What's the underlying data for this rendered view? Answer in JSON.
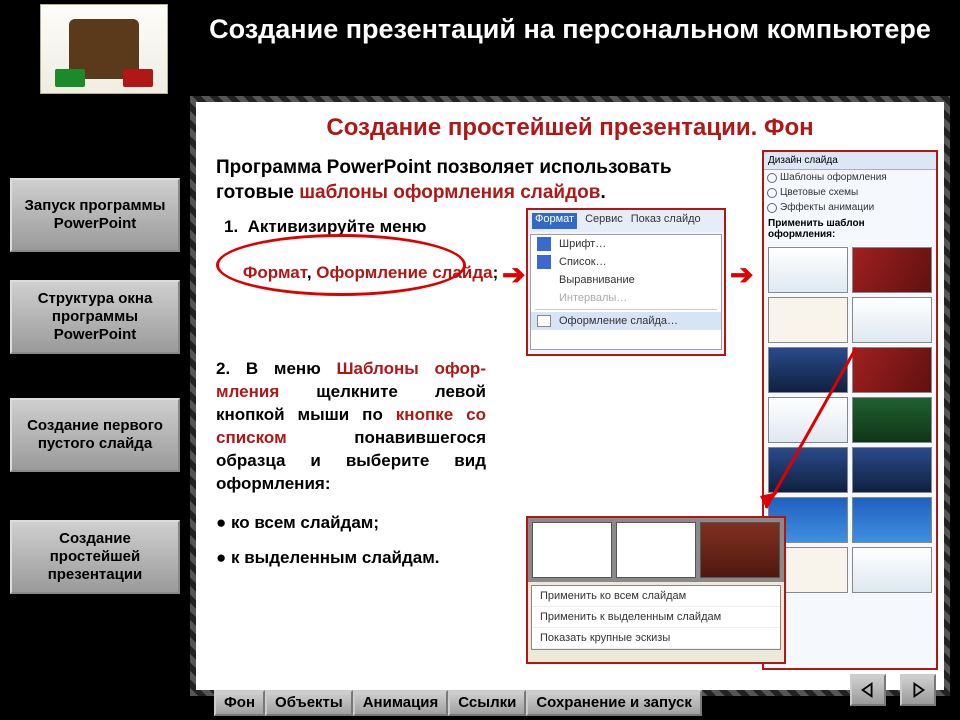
{
  "header": {
    "title": "Создание презентаций на персональном компьютере",
    "subtitle": "Создание простейшей презентации. Фон"
  },
  "sidebar": {
    "buttons": [
      "Запуск программы PowerPoint",
      "Структура окна программы PowerPoint",
      "Создание первого пустого слайда",
      "Создание простейшей презентации"
    ]
  },
  "content": {
    "intro_plain": "Программа PowerPoint позволяет использовать готовые ",
    "intro_red": "шаблоны оформления слайдов",
    "intro_end": ".",
    "step1_num": "1.",
    "step1_a": "Активизируйте меню",
    "step1_red1": "Формат",
    "step1_comma": ", ",
    "step1_red2": "Оформление слайда",
    "step1_end": ";",
    "step2_a": "2. В меню ",
    "step2_red1": "Шаблоны офор­мления",
    "step2_b": " щелкните левой кнопкой мыши по ",
    "step2_red2": "кнопке со списком",
    "step2_c": " понавившегося образца и выберите вид оформления:",
    "bullet1": "● ко всем слайдам;",
    "bullet2": "● к выделенным слайдам."
  },
  "menu": {
    "bar": [
      "Формат",
      "Сервис",
      "Показ слайдо"
    ],
    "items": [
      "Шрифт…",
      "Список…",
      "Выравнивание",
      "Интервалы…",
      "Оформление слайда…"
    ]
  },
  "panel": {
    "header": "Дизайн слайда",
    "opts": [
      "Шаблоны оформления",
      "Цветовые схемы",
      "Эффекты анимации"
    ],
    "label": "Применить шаблон оформления:"
  },
  "context": {
    "items": [
      "Применить ко всем слайдам",
      "Применить к выделенным слайдам",
      "Показать крупные эскизы"
    ]
  },
  "tabs": [
    "Фон",
    "Объекты",
    "Анимация",
    "Ссылки",
    "Сохранение и запуск"
  ]
}
